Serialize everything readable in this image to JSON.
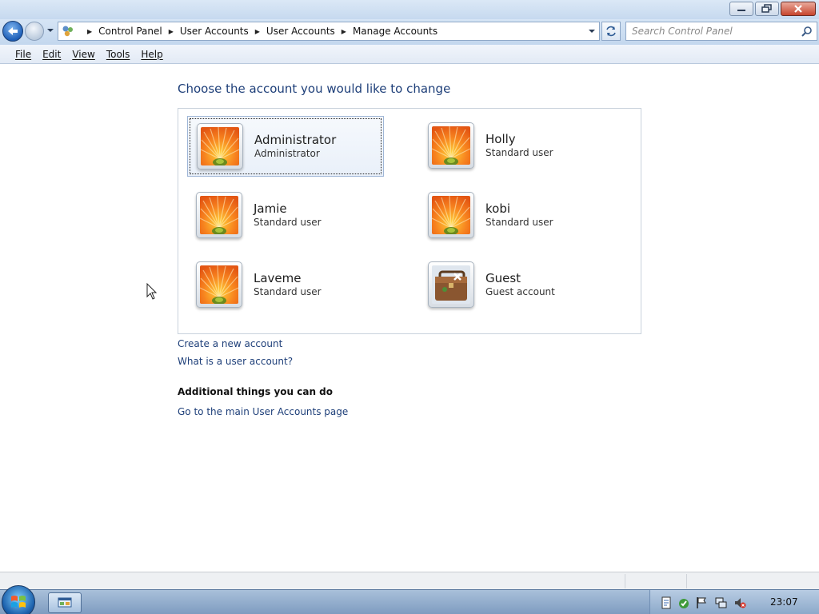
{
  "address": {
    "crumbs": [
      "Control Panel",
      "User Accounts",
      "User Accounts",
      "Manage Accounts"
    ]
  },
  "search": {
    "placeholder": "Search Control Panel"
  },
  "menu": [
    "File",
    "Edit",
    "View",
    "Tools",
    "Help"
  ],
  "main": {
    "heading": "Choose the account you would like to change",
    "accounts": [
      {
        "name": "Administrator",
        "type": "Administrator",
        "picture": "flower",
        "selected": true
      },
      {
        "name": "Holly",
        "type": "Standard user",
        "picture": "flower"
      },
      {
        "name": "Jamie",
        "type": "Standard user",
        "picture": "flower"
      },
      {
        "name": "kobi",
        "type": "Standard user",
        "picture": "flower"
      },
      {
        "name": "Laveme",
        "type": "Standard user",
        "picture": "flower"
      },
      {
        "name": "Guest",
        "type": "Guest account",
        "picture": "briefcase"
      }
    ],
    "links": {
      "create": "Create a new account",
      "what": "What is a user account?"
    },
    "additional": {
      "title": "Additional things you can do",
      "main_page": "Go to the main User Accounts page"
    }
  },
  "taskbar": {
    "clock": "23:07"
  },
  "icons": {
    "back": "back-arrow-icon",
    "forward": "forward-arrow-icon",
    "refresh": "refresh-icon",
    "search": "magnifier-icon",
    "flower": "orange-flower-picture",
    "guest": "briefcase-picture"
  }
}
